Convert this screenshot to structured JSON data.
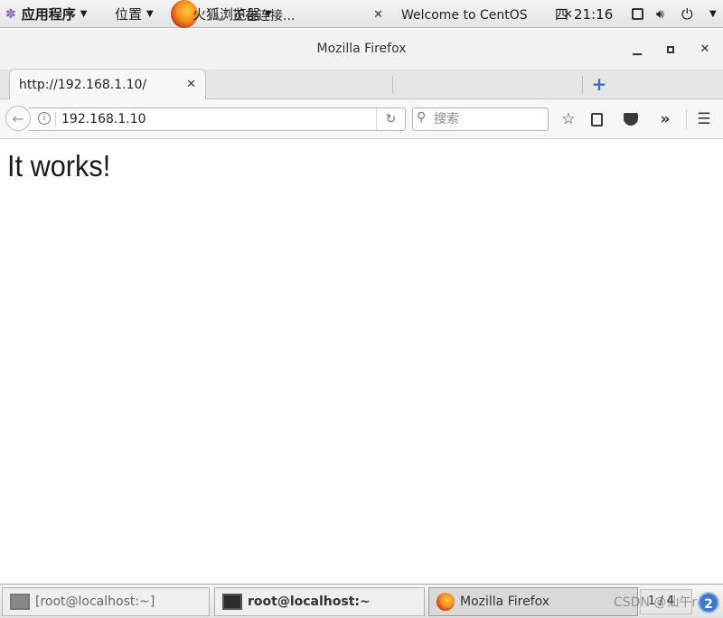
{
  "topbar": {
    "apps_menu": "应用程序",
    "places_menu": "位置",
    "browser_menu": "火狐浏览器",
    "clock_day": "四",
    "clock_time": "21:16",
    "icons": [
      "apps-icon",
      "firefox-logo",
      "screen-icon",
      "volume-icon",
      "power-icon"
    ]
  },
  "window": {
    "title": "Mozilla Firefox"
  },
  "tabs": [
    {
      "label": "http://192.168.1.10/",
      "active": true
    },
    {
      "label": "正在连接...",
      "active": false
    },
    {
      "label": "Welcome to CentOS",
      "active": false
    }
  ],
  "navbar": {
    "url": "192.168.1.10",
    "search_placeholder": "搜索"
  },
  "page": {
    "heading": "It works!"
  },
  "taskbar": {
    "items": [
      {
        "label": "[root@localhost:~]",
        "icon": "terminal-icon"
      },
      {
        "label": "root@localhost:~",
        "icon": "terminal-icon"
      },
      {
        "label": "Mozilla Firefox",
        "icon": "firefox-icon"
      }
    ],
    "workspace": "1 / 4",
    "badge": "2"
  },
  "watermark": "CSDN @仙午roc"
}
